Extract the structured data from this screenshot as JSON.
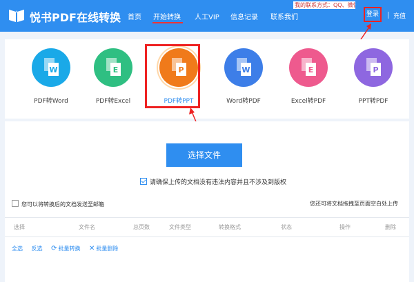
{
  "header": {
    "logo_text": "悦书PDF在线转换",
    "contact_text": "我的联系方式：QQ、微信。",
    "nav": [
      {
        "label": "首页"
      },
      {
        "label": "开始转换"
      },
      {
        "label": "人工VIP"
      },
      {
        "label": "信息记录"
      },
      {
        "label": "联系我们"
      }
    ],
    "login_label": "登录",
    "recharge_label": "充值"
  },
  "tools": [
    {
      "label": "PDF转Word",
      "letter": "W",
      "color": "#1aa9e8",
      "active": false
    },
    {
      "label": "PDF转Excel",
      "letter": "E",
      "color": "#2fbf82",
      "active": false
    },
    {
      "label": "PDF转PPT",
      "letter": "P",
      "color": "#f07a1a",
      "active": true
    },
    {
      "label": "Word转PDF",
      "letter": "W",
      "color": "#3d7ee8",
      "active": false
    },
    {
      "label": "Excel转PDF",
      "letter": "E",
      "color": "#ee5a8e",
      "active": false
    },
    {
      "label": "PPT转PDF",
      "letter": "P",
      "color": "#8e67e0",
      "active": false
    }
  ],
  "upload": {
    "select_label": "选择文件",
    "agree_text": "请确保上传的文档没有违法内容并且不涉及到版权",
    "email_text": "您可以将转换后的文档发送至邮箱",
    "drag_tip": "您还可将文档拖拽至页面空白处上传"
  },
  "table": {
    "headers": [
      "选择",
      "文件名",
      "总页数",
      "文件类型",
      "转换格式",
      "状态",
      "操作",
      "删除"
    ]
  },
  "bulk": {
    "select_all": "全选",
    "invert": "反选",
    "batch_convert": "批量转换",
    "batch_delete": "批量删除"
  },
  "colors": {
    "brand": "#2f8ef0",
    "highlight": "#e22222"
  }
}
